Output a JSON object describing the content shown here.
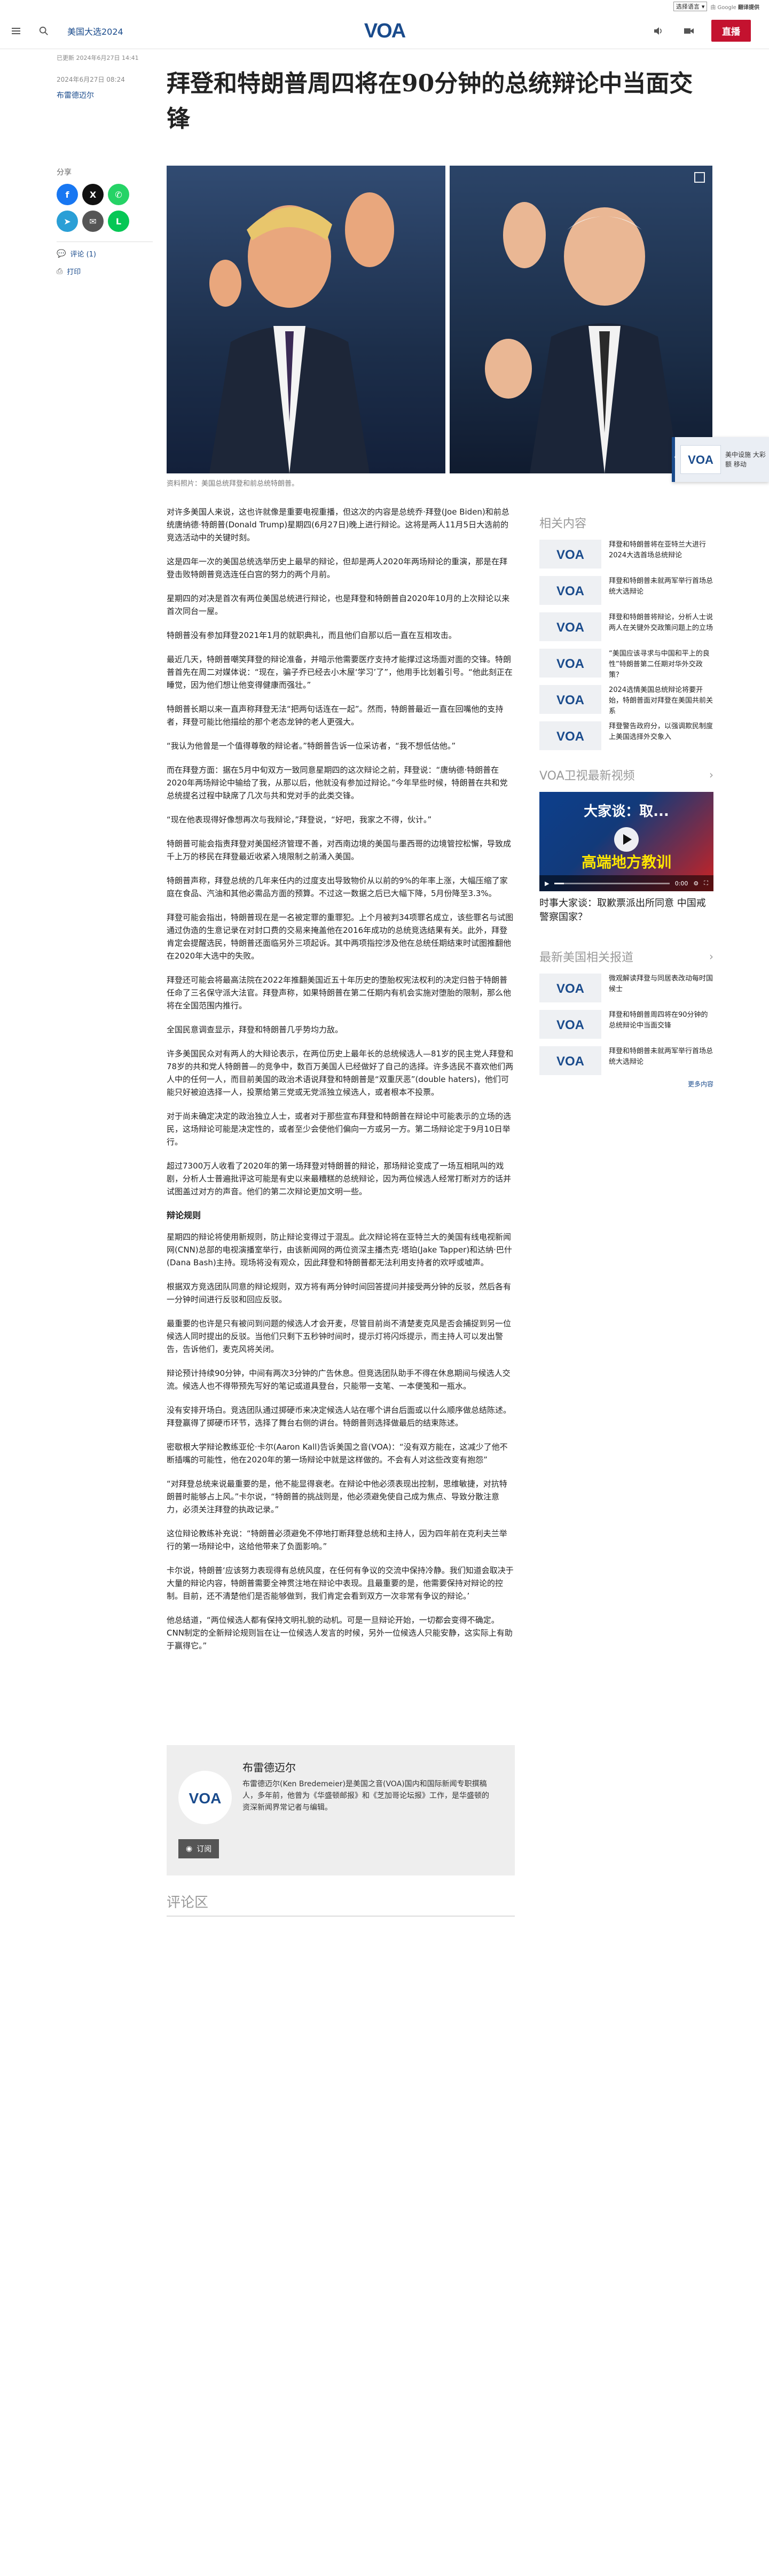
{
  "translate": {
    "select_label": "选择语言",
    "powered_by": "由 Google",
    "powered_brand": "翻译提供"
  },
  "header": {
    "section": "美国大选2024",
    "live_label": "直播",
    "logo_text": "VOA"
  },
  "article": {
    "updated": "已更新 2024年6月27日 14:41",
    "published_line": "2024年6月27日 08:24",
    "author": "布雷德迈尔",
    "title": "拜登和特朗普周四将在90分钟的总统辩论中当面交锋",
    "caption": "资料照片：美国总统拜登和前总统特朗普。",
    "paragraphs": [
      "对许多美国人来说，这也许就像是重要电视重播，但这次的内容是总统乔·拜登(Joe Biden)和前总统唐纳德·特朗普(Donald Trump)星期四(6月27日)晚上进行辩论。这将是两人11月5日大选前的竞选活动中的关键时刻。",
      "这是四年一次的美国总统选举历史上最早的辩论，但却是两人2020年两场辩论的重演，那是在拜登击败特朗普竞选连任白宫的努力的两个月前。",
      "星期四的对决是首次有两位美国总统进行辩论，也是拜登和特朗普自2020年10月的上次辩论以来首次同台一屋。",
      "特朗普没有参加拜登2021年1月的就职典礼，而且他们自那以后一直在互相攻击。",
      "最近几天，特朗普嘲笑拜登的辩论准备，并暗示他需要医疗支持才能撑过这场面对面的交锋。特朗普首先在周二对媒体说：“现在，骗子乔已经去小木屋‘学习’了”，他用手比划着引号。“他此刻正在睡觉，因为他们想让他变得健康而强壮。”",
      "特朗普长期以来一直声称拜登无法“把两句话连在一起”。然而，特朗普最近一直在回嘴他的支持者，拜登可能比他描绘的那个老态龙钟的老人更强大。",
      "“我认为他曾是一个值得尊敬的辩论者。”特朗普告诉一位采访者，“我不想低估他。”",
      "而在拜登方面：据在5月中旬双方一致同意星期四的这次辩论之前，拜登说：“唐纳德·特朗普在2020年两场辩论中输给了我，从那以后，他就没有参加过辩论。”今年早些时候，特朗普在共和党总统提名过程中缺席了几次与共和党对手的此类交锋。",
      "“现在他表现得好像想再次与我辩论，”拜登说，“好吧，我家之不得，伙计。”",
      "特朗普可能会指责拜登对美国经济管理不善，对西南边境的美国与墨西哥的边境管控松懈，导致成千上万的移民在拜登最近收紧入境限制之前涌入美国。",
      "特朗普声称，拜登总统的几年来任内的过度支出导致物价从以前的9%的年率上涨，大幅压缩了家庭在食品、汽油和其他必需品方面的预算。不过这一数据之后已大幅下降，5月份降至3.3%。",
      "拜登可能会指出，特朗普现在是一名被定罪的重罪犯。上个月被判34项罪名成立，该些罪名与试图通过伪造的生意记录在对封口费的交易来掩盖他在2016年成功的总统竞选结果有关。此外，拜登肯定会提醒选民，特朗普还面临另外三项起诉。其中两项指控涉及他在总统任期结束时试图推翻他在2020年大选中的失败。",
      "拜登还可能会将最高法院在2022年推翻美国近五十年历史的堕胎权宪法权利的决定归咎于特朗普任命了三名保守派大法官。拜登声称，如果特朗普在第二任期内有机会实施对堕胎的限制，那么他将在全国范围内推行。",
      "全国民意调查显示，拜登和特朗普几乎势均力敌。",
      "许多美国民众对有两人的大辩论表示，在两位历史上最年长的总统候选人—81岁的民主党人拜登和78岁的共和党人特朗普—的竞争中，数百万美国人已经做好了自己的选择。许多选民不喜欢他们两人中的任何一人，而目前美国的政治术语说拜登和特朗普是“双重厌恶”(double haters)，他们可能只好被迫选择一人，投票给第三党或无党派独立候选人，或者根本不投票。",
      "对于尚未确定决定的政治独立人士，或者对于那些宣布拜登和特朗普在辩论中可能表示的立场的选民，这场辩论可能是决定性的，或者至少会使他们偏向一方或另一方。第二场辩论定于9月10日举行。",
      "超过7300万人收看了2020年的第一场拜登对特朗普的辩论，那场辩论变成了一场互相吼叫的戏剧，分析人士普遍批评这可能是有史以来最糟糕的总统辩论，因为两位候选人经常打断对方的话并试图盖过对方的声音。他们的第二次辩论更加文明一些。",
      "辩论规则",
      "星期四的辩论将使用新规则，防止辩论变得过于混乱。此次辩论将在亚特兰大的美国有线电视新闻网(CNN)总部的电视演播室举行，由该新闻网的两位资深主播杰克·塔珀(Jake Tapper)和达纳·巴什(Dana Bash)主持。现场将没有观众，因此拜登和特朗普都无法利用支持者的欢呼或嘘声。",
      "根据双方竞选团队同意的辩论规则，双方将有两分钟时间回答提问并接受两分钟的反驳，然后各有一分钟时间进行反驳和回应反驳。",
      "最重要的也许是只有被问到问题的候选人才会开麦，尽管目前尚不清楚麦克风是否会捕捉到另一位候选人同时提出的反驳。当他们只剩下五秒钟时间时，提示灯将闪烁提示，而主持人可以发出警告，告诉他们，麦克风将关闭。",
      "辩论预计持续90分钟，中间有两次3分钟的广告休息。但竞选团队助手不得在休息期间与候选人交流。候选人也不得带预先写好的笔记或道具登台，只能带一支笔、一本便笺和一瓶水。",
      "没有安排开场白。竞选团队通过掷硬币来决定候选人站在哪个讲台后面或以什么顺序做总结陈述。拜登赢得了掷硬币环节，选择了舞台右侧的讲台。特朗普则选择做最后的结束陈述。",
      "密歇根大学辩论教练亚伦·卡尔(Aaron Kall)告诉美国之音(VOA)：“没有双方能在，这减少了他不断插嘴的可能性，他在2020年的第一场辩论中就是这样做的。不会有人对这些改变有抱怨”",
      "“对拜登总统来说最重要的是，他不能显得衰老。在辩论中他必须表现出控制，思维敏捷，对抗特朗普时能够占上风。”卡尔说，“特朗普的挑战则是，他必须避免使自己成为焦点、导致分散注意力，必须关注拜登的执政记录。”",
      "这位辩论教练补充说：“特朗普必须避免不停地打断拜登总统和主持人，因为四年前在克利夫兰举行的第一场辩论中，这给他带来了负面影响。”",
      "卡尔说，特朗普‘应该努力表现得有总统风度，在任何有争议的交流中保持冷静。我们知道会取决于大量的辩论内容，特朗普需要全神贯注地在辩论中表现。且最重要的是，他需要保持对辩论的控制。目前，还不清楚他们是否能够做到，我们肯定会看到双方一次非常有争议的辩论。’",
      "他总结道，“两位候选人都有保持文明礼貌的动机。可是一旦辩论开始，一切都会变得不确定。CNN制定的全新辩论规则旨在让一位候选人发言的时候，另外一位候选人只能安静，这实际上有助于赢得它。”"
    ]
  },
  "share": {
    "label": "分享",
    "comments_label": "评论 (1)",
    "print_label": "打印"
  },
  "author_box": {
    "name": "布雷德迈尔",
    "bio": "布雷德迈尔(Ken Bredemeier)是美国之音(VOA)国内和国际新闻专职撰稿人，多年前，他曾为《华盛顿邮报》和《芝加哥论坛报》工作，是华盛顿的资深新闻界常记者与编辑。",
    "subscribe_label": "订阅"
  },
  "comments_heading": "评论区",
  "float_player": {
    "text": "美中设施 大彩 额 移动 "
  },
  "sidebar": {
    "related_heading": "相关内容",
    "related": [
      "拜登和特朗普将在亚特兰大进行2024大选首场总统辩论",
      "拜登和特朗普未就两军举行首场总统大选辩论",
      "拜登和特朗普将辩论，分析人士说两人在关键外交政策问题上的立场",
      "“美国应该寻求与中国和平上的良性”特朗普第二任期对华外交政策？",
      "2024选情美国总统辩论将要开始，特朗普面对拜登在美国共前关系",
      "拜登警告政府分，以强调欺民制度上美国选择外交象入"
    ],
    "video_heading": "VOA卫视最新视频",
    "video_overlay_title": "大家谈：取...",
    "video_overlay_sub": "高端地方教训",
    "video_time": "0:00",
    "video_progress": 0.08,
    "video_caption": "时事大家谈：取歉票派出所同意 中国戒警察国家？",
    "latest_heading": "最新美国相关报道",
    "latest": [
      "微观解读拜登与同居表改动每时国候士",
      "拜登和特朗普周四将在90分钟的总统辩论中当面交锋",
      "拜登和特朗普未就两军举行首场总统大选辩论"
    ],
    "more_label": "更多内容"
  },
  "colors": {
    "brand": "#1a4b8c",
    "live": "#c4122f"
  }
}
